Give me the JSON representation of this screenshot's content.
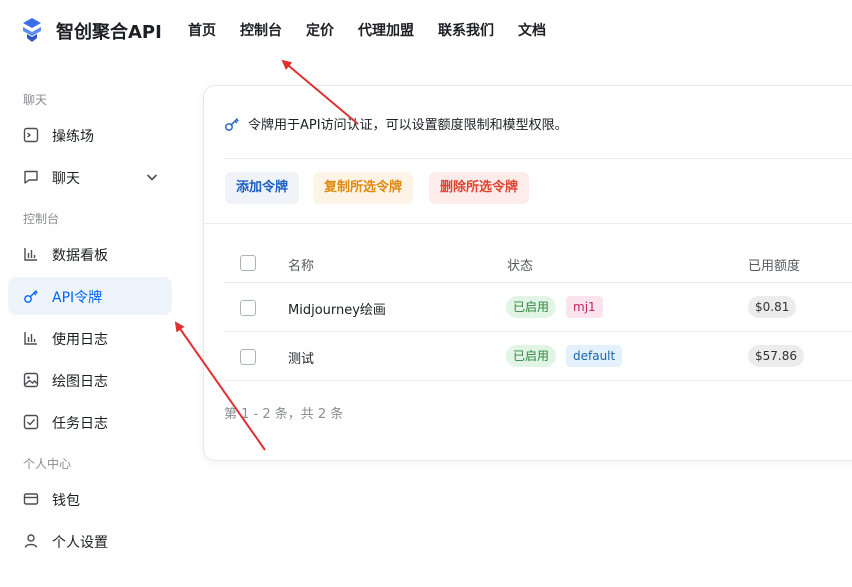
{
  "header": {
    "brand": "智创聚合API",
    "nav": [
      "首页",
      "控制台",
      "定价",
      "代理加盟",
      "联系我们",
      "文档"
    ]
  },
  "sidebar": {
    "sections": [
      "聊天",
      "控制台",
      "个人中心"
    ],
    "items": [
      {
        "label": "操练场",
        "icon": "terminal-icon"
      },
      {
        "label": "聊天",
        "icon": "chat-icon"
      },
      {
        "label": "数据看板",
        "icon": "bar-chart-icon"
      },
      {
        "label": "API令牌",
        "icon": "key-icon",
        "active": true
      },
      {
        "label": "使用日志",
        "icon": "bar-chart-icon"
      },
      {
        "label": "绘图日志",
        "icon": "image-icon"
      },
      {
        "label": "任务日志",
        "icon": "checkbox-icon"
      },
      {
        "label": "钱包",
        "icon": "wallet-icon"
      },
      {
        "label": "个人设置",
        "icon": "user-icon"
      }
    ]
  },
  "main": {
    "description": "令牌用于API访问认证，可以设置额度限制和模型权限。",
    "buttons": {
      "add": "添加令牌",
      "copy": "复制所选令牌",
      "delete": "删除所选令牌"
    },
    "table": {
      "headers": [
        "名称",
        "状态",
        "已用额度"
      ],
      "rows": [
        {
          "name": "Midjourney绘画",
          "status": "已启用",
          "group": "mj1",
          "used": "$0.81"
        },
        {
          "name": "测试",
          "status": "已启用",
          "group": "default",
          "used": "$57.86"
        }
      ]
    },
    "pagination": "第 1 - 2 条，共 2 条"
  },
  "colors": {
    "accent": "#0064fa",
    "arrow": "#e03131"
  }
}
